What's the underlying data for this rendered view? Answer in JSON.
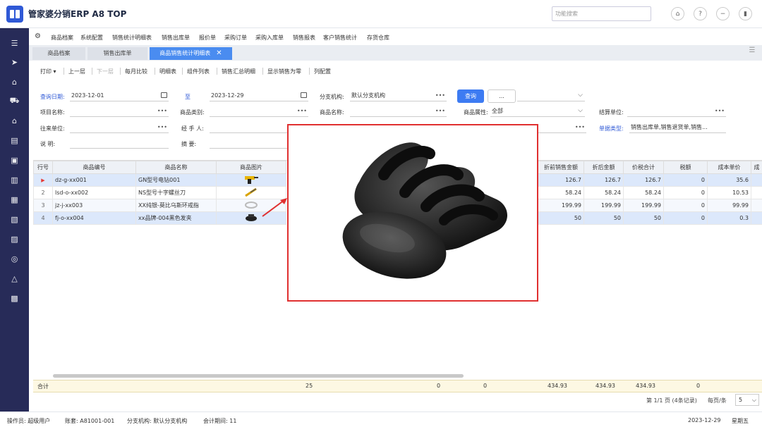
{
  "app": {
    "title": "管家婆分销ERP A8 TOP",
    "search_placeholder": "功能搜索"
  },
  "menu": [
    "商品档案",
    "系统配置",
    "销售统计明细表",
    "销售出库单",
    "报价单",
    "采购订单",
    "采购入库单",
    "销售报表",
    "客户销售统计",
    "存货仓库"
  ],
  "tabs": [
    {
      "label": "商品档案"
    },
    {
      "label": "销售出库单"
    },
    {
      "label": "商品销售统计明细表",
      "active": true
    }
  ],
  "toolbar": [
    "打印 ▾",
    "上一层",
    "下一层",
    "每月比较",
    "明细表",
    "组件列表",
    "销售汇总明细",
    "显示销售为零",
    "列配置"
  ],
  "form": {
    "date_from_label": "查询日期:",
    "date_from": "2023-12-01",
    "date_to_label": "至",
    "date_to": "2023-12-29",
    "branch_label": "分支机构:",
    "branch": "默认分支机构",
    "query_button": "查询",
    "more_button": "...",
    "project_label": "项目名称:",
    "category_label": "商品类别:",
    "product_label": "商品名称:",
    "attr_label": "商品属性:",
    "attr_value": "全部",
    "unit_label": "结算单位:",
    "partner_label": "往来单位:",
    "handler_label": "经 手 人:",
    "doc_type_label": "单据类型:",
    "doc_type": "销售出库单,销售退货单,销售...",
    "note_label": "说 明:",
    "summary_label": "摘 要:"
  },
  "table": {
    "columns_left": [
      "行号",
      "商品编号",
      "商品名称",
      "商品图片"
    ],
    "columns_right": [
      "折前销售金额",
      "折后金额",
      "价税合计",
      "税额",
      "成本单价",
      "成"
    ],
    "rows": [
      {
        "no": "1",
        "code": "dz-g-xx001",
        "name": "GN型号电钻001",
        "pre": "126.7",
        "after": "126.7",
        "total": "126.7",
        "tax": "0",
        "cost": "35.6"
      },
      {
        "no": "2",
        "code": "lsd-o-xx002",
        "name": "NS型号十字螺丝刀",
        "pre": "58.24",
        "after": "58.24",
        "total": "58.24",
        "tax": "0",
        "cost": "10.53"
      },
      {
        "no": "3",
        "code": "jz-j-xx003",
        "name": "XX纯银-莫比乌斯环戒指",
        "pre": "199.99",
        "after": "199.99",
        "total": "199.99",
        "tax": "0",
        "cost": "99.99"
      },
      {
        "no": "4",
        "code": "fj-o-xx004",
        "name": "xx品牌-004黑色发夹",
        "pre": "50",
        "after": "50",
        "total": "50",
        "tax": "0",
        "cost": "0.3"
      }
    ],
    "totals_label": "合计",
    "totals": {
      "qty": "25",
      "v1": "0",
      "v2": "0",
      "pre": "434.93",
      "after": "434.93",
      "total": "434.93",
      "tax": "0"
    }
  },
  "pager": {
    "info": "第 1/1 页 (4条记录)",
    "per_page_label": "每页/条",
    "per_page": "5"
  },
  "status": {
    "operator": "操作员: 超级用户",
    "account": "账套: A81001-001",
    "branch": "分支机构: 默认分支机构",
    "period": "会计期间: 11",
    "date": "2023-12-29",
    "weekday": "星期五"
  },
  "colors": {
    "sidebar": "#272b58",
    "accent": "#3d7bf2",
    "preview_border": "#e03030"
  }
}
